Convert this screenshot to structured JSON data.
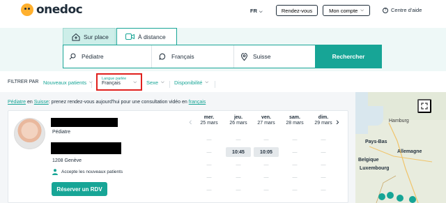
{
  "header": {
    "logo_text": "onedoc",
    "language": "FR",
    "appointments_button": "Rendez-vous",
    "account_button": "Mon compte",
    "help_link": "Centre d'aide"
  },
  "search": {
    "tabs": [
      {
        "label": "Sur place",
        "active": false
      },
      {
        "label": "À distance",
        "active": true
      }
    ],
    "speciality": "Pédiatre",
    "language": "Français",
    "location": "Suisse",
    "submit_label": "Rechercher"
  },
  "filters": {
    "label": "FILTRER PAR",
    "new_patients": "Nouveaux patients",
    "language_caption": "Langue parlée",
    "language_value": "Français",
    "sex": "Sexe",
    "availability": "Disponibilité"
  },
  "notice": {
    "speciality_link": "Pédiatre",
    "connector": " en ",
    "country_link": "Suisse",
    "text": ": prenez rendez-vous aujourd'hui pour une consultation vidéo en ",
    "language_link": "français"
  },
  "result": {
    "specialty": "Pédiatre",
    "city": "1208 Genève",
    "accepts_new_patients": "Accepte les nouveaux patients",
    "book_button": "Réserver un RDV",
    "days": [
      {
        "name": "mer.",
        "date": "25 mars"
      },
      {
        "name": "jeu.",
        "date": "26 mars"
      },
      {
        "name": "ven.",
        "date": "27 mars"
      },
      {
        "name": "sam.",
        "date": "28 mars"
      },
      {
        "name": "dim.",
        "date": "29 mars"
      }
    ],
    "slot_rows": [
      [
        "—",
        "—",
        "—",
        "—",
        "—"
      ],
      [
        "—",
        "10:45",
        "10:05",
        "—",
        "—"
      ],
      [
        "—",
        "—",
        "—",
        "—",
        "—"
      ],
      [
        "—",
        "—",
        "—",
        "—",
        "—"
      ],
      [
        "—",
        "—",
        "—",
        "—",
        "—"
      ]
    ]
  },
  "map": {
    "labels": [
      "Hamburg",
      "Pays-Bas",
      "Allemagne",
      "Belgique",
      "Luxembourg"
    ]
  },
  "colors": {
    "brand": "#17a596",
    "highlight": "#e0201d",
    "text": "#1f2d3a"
  }
}
